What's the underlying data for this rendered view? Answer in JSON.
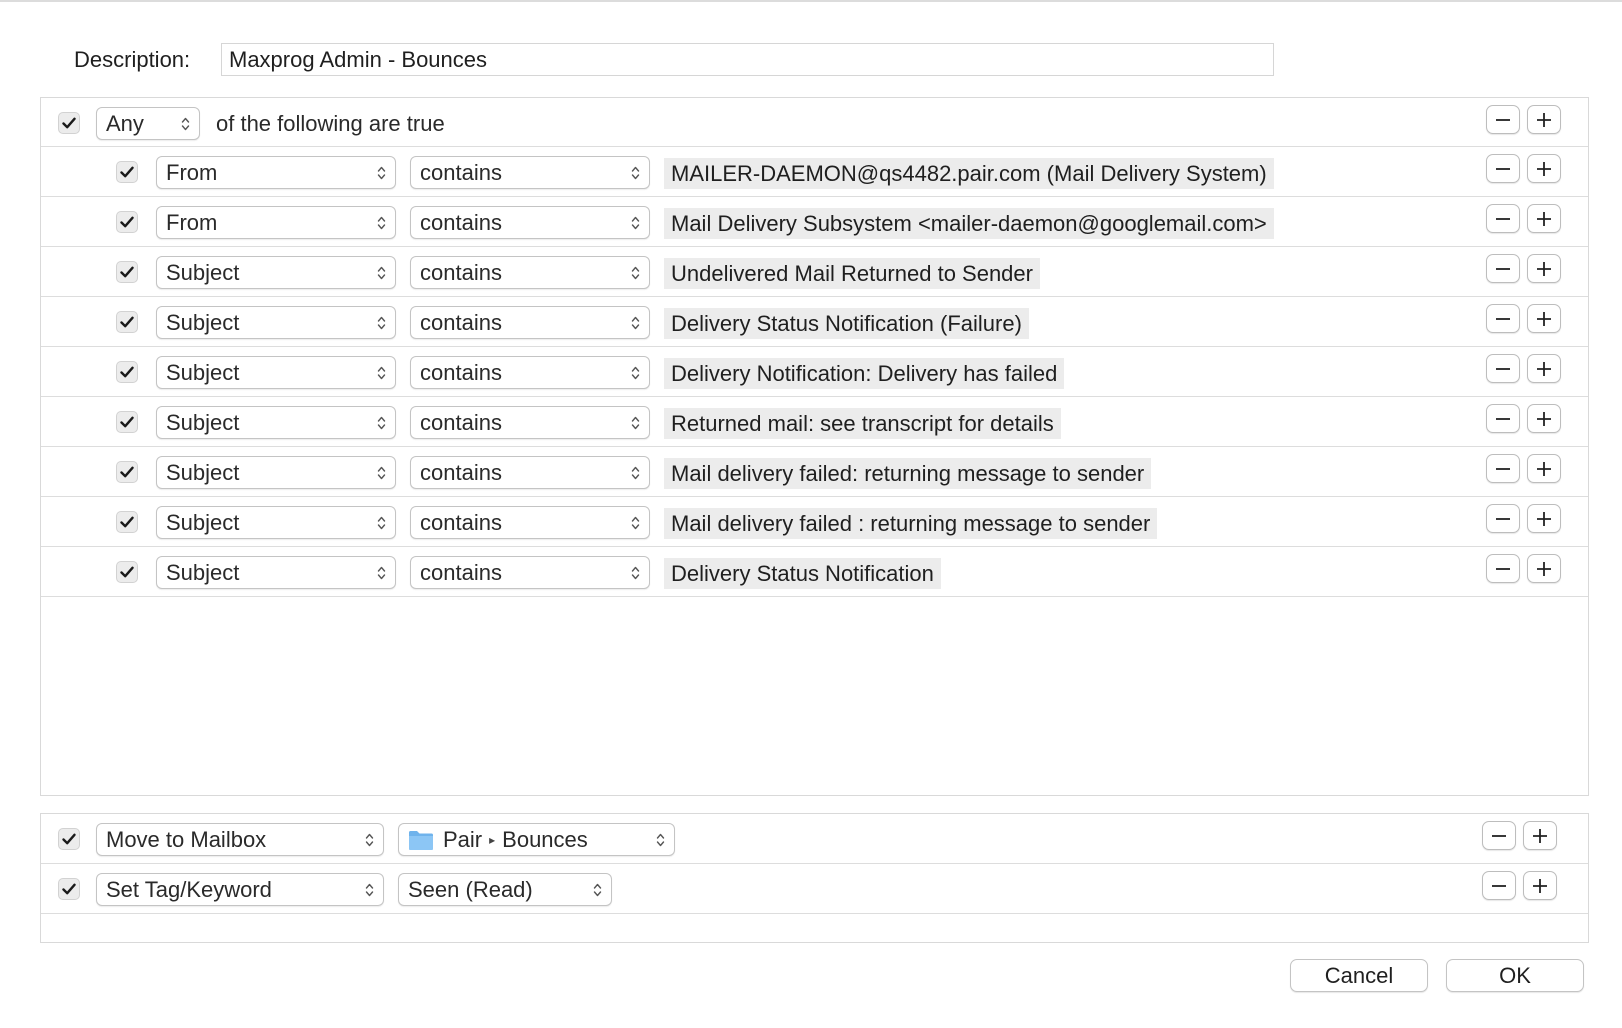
{
  "description": {
    "label": "Description:",
    "value": "Maxprog Admin - Bounces"
  },
  "match": {
    "checked": true,
    "quantifier": "Any",
    "suffix": "of the following are true"
  },
  "criteria": [
    {
      "checked": true,
      "field": "From",
      "operator": "contains",
      "value": "MAILER-DAEMON@qs4482.pair.com (Mail Delivery System)"
    },
    {
      "checked": true,
      "field": "From",
      "operator": "contains",
      "value": "Mail Delivery Subsystem <mailer-daemon@googlemail.com>"
    },
    {
      "checked": true,
      "field": "Subject",
      "operator": "contains",
      "value": "Undelivered Mail Returned to Sender"
    },
    {
      "checked": true,
      "field": "Subject",
      "operator": "contains",
      "value": "Delivery Status Notification (Failure)"
    },
    {
      "checked": true,
      "field": "Subject",
      "operator": "contains",
      "value": "Delivery Notification: Delivery has failed"
    },
    {
      "checked": true,
      "field": "Subject",
      "operator": "contains",
      "value": "Returned mail: see transcript for details"
    },
    {
      "checked": true,
      "field": "Subject",
      "operator": "contains",
      "value": "Mail delivery failed: returning message to sender"
    },
    {
      "checked": true,
      "field": "Subject",
      "operator": "contains",
      "value": "Mail delivery failed  : returning message to sender"
    },
    {
      "checked": true,
      "field": "Subject",
      "operator": "contains",
      "value": "Delivery Status Notification"
    }
  ],
  "actions": [
    {
      "checked": true,
      "action": "Move to Mailbox",
      "target_icon": "folder-icon",
      "target_path": [
        "Pair",
        "Bounces"
      ]
    },
    {
      "checked": true,
      "action": "Set Tag/Keyword",
      "target": "Seen (Read)"
    }
  ],
  "buttons": {
    "cancel": "Cancel",
    "ok": "OK"
  },
  "icons": {
    "checkbox": "checkmark-icon",
    "remove": "minus-icon",
    "add": "plus-icon",
    "popup": "up-down-arrows-icon"
  }
}
